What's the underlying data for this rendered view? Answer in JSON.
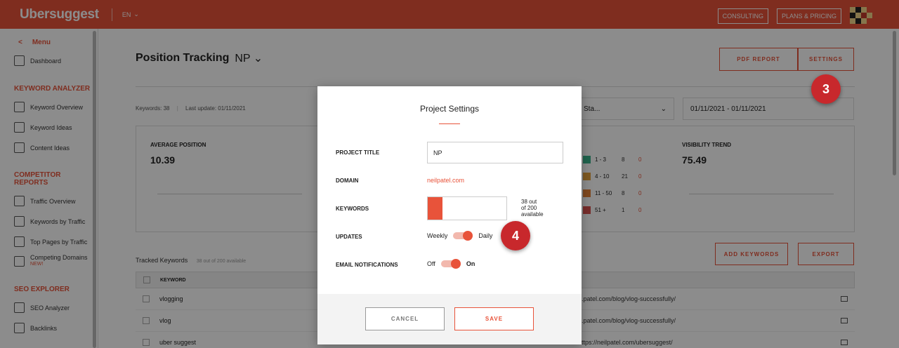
{
  "header": {
    "logo": "Ubersuggest",
    "language": "EN",
    "consulting": "CONSULTING",
    "plans": "PLANS & PRICING"
  },
  "sidebar": {
    "menu": "Menu",
    "dashboard": "Dashboard",
    "sections": [
      {
        "heading": "KEYWORD ANALYZER",
        "items": [
          "Keyword Overview",
          "Keyword Ideas",
          "Content Ideas"
        ]
      },
      {
        "heading": "COMPETITOR REPORTS",
        "items": [
          "Traffic Overview",
          "Keywords by Traffic",
          "Top Pages by Traffic",
          "Competing Domains"
        ]
      },
      {
        "heading": "SEO EXPLORER",
        "items": [
          "SEO Analyzer",
          "Backlinks"
        ]
      }
    ],
    "new_badge": "NEW!"
  },
  "main": {
    "title": "Position Tracking",
    "project": "NP",
    "pdf_report": "PDF REPORT",
    "settings": "SETTINGS",
    "keywords_count": "Keywords: 38",
    "last_update": "Last update: 01/11/2021",
    "filter_value": "Sta...",
    "date_range": "01/11/2021 - 01/11/2021",
    "avg_position_label": "AVERAGE POSITION",
    "avg_position_value": "10.39",
    "visibility_label": "VISIBILITY TREND",
    "visibility_value": "75.49",
    "distribution": [
      {
        "range": "1 - 3",
        "count": "8",
        "change": "0",
        "color": "#3bb58c"
      },
      {
        "range": "4 - 10",
        "count": "21",
        "change": "0",
        "color": "#e6a23c"
      },
      {
        "range": "11 - 50",
        "count": "8",
        "change": "0",
        "color": "#e8833a"
      },
      {
        "range": "51 +",
        "count": "1",
        "change": "0",
        "color": "#d9534f"
      }
    ],
    "tracked_label": "Tracked Keywords",
    "tracked_note": "38 out of 200 available",
    "add_keywords": "ADD KEYWORDS",
    "export": "EXPORT",
    "col_keyword": "KEYWORD",
    "rows": [
      {
        "keyword": "vlogging",
        "url": "...patel.com/blog/vlog-successfully/"
      },
      {
        "keyword": "vlog",
        "url": "...patel.com/blog/vlog-successfully/"
      },
      {
        "keyword": "uber suggest",
        "url": "https://neilpatel.com/ubersuggest/"
      }
    ]
  },
  "modal": {
    "title": "Project Settings",
    "project_title_label": "PROJECT TITLE",
    "project_title_value": "NP",
    "domain_label": "DOMAIN",
    "domain_value": "neilpatel.com",
    "keywords_label": "KEYWORDS",
    "keywords_used": 38,
    "keywords_total": 200,
    "keywords_note_1": "38 out",
    "keywords_note_2": "of 200",
    "keywords_note_3": "available",
    "updates_label": "UPDATES",
    "updates_off": "Weekly",
    "updates_on": "Daily",
    "email_label": "EMAIL NOTIFICATIONS",
    "email_off": "Off",
    "email_on": "On",
    "cancel": "CANCEL",
    "save": "SAVE"
  },
  "badges": {
    "step3": "3",
    "step4": "4"
  },
  "colors": {
    "brand": "#e8533a",
    "badge": "#c8282c"
  }
}
